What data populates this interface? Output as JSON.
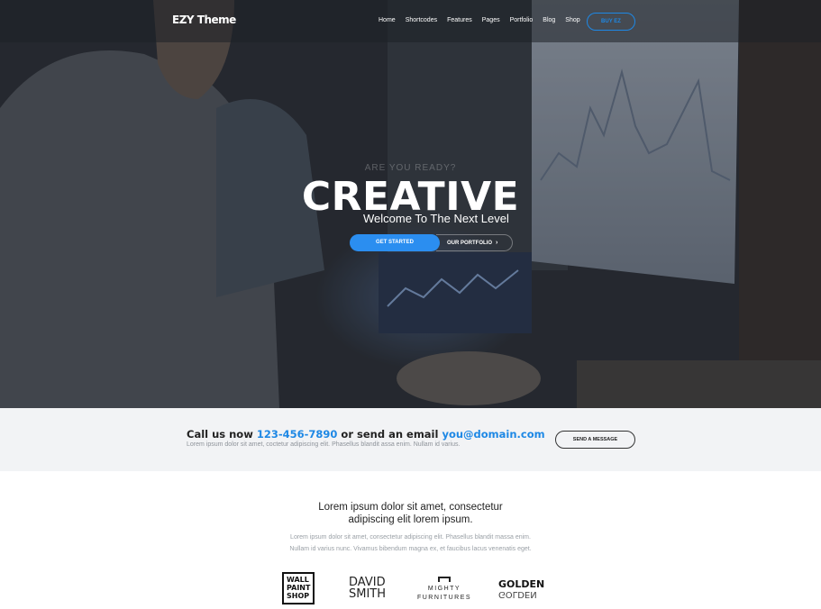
{
  "nav": {
    "logo": "EZY Theme",
    "items": [
      "Home",
      "Shortcodes",
      "Features",
      "Pages",
      "Portfolio",
      "Blog",
      "Shop"
    ],
    "buy_label": "BUY EZ"
  },
  "hero": {
    "subtitle": "ARE YOU READY?",
    "title": "CREATIVE",
    "tagline": "Welcome To The Next Level",
    "primary_cta": "GET STARTED",
    "secondary_cta": "OUR PORTFOLIO"
  },
  "callbar": {
    "prefix": "Call us now ",
    "phone": "123-456-7890",
    "middle": " or send an email ",
    "email": "you@domain.com",
    "description": "Lorem ipsum dolor sit amet, coctetur adipiscing elit. Phasellus blandit assa enim. Nullam id varius.",
    "button_label": "SEND A MESSAGE"
  },
  "intro": {
    "title_line1": "Lorem ipsum dolor sit amet, consectetur",
    "title_line2": "adipiscing elit lorem ipsum.",
    "text_line1": "Lorem ipsum dolor sit amet, consectetur adipiscing elit. Phasellus blandit massa enim.",
    "text_line2": "Nullam id varius nunc. Vivamus bibendum magna ex, et faucibus lacus venenatis eget."
  },
  "clients": {
    "wall_line1": "WALL",
    "wall_line2": "PAINT",
    "wall_line3": "SHOP",
    "david_line1": "DAVID",
    "david_line2": "SMITH",
    "mighty_line1": "MIGHTY",
    "mighty_line2": "FURNITURES",
    "golden": "GOLDEN"
  },
  "colors": {
    "accent": "#1e88e5",
    "callbar_bg": "#f2f3f5"
  }
}
